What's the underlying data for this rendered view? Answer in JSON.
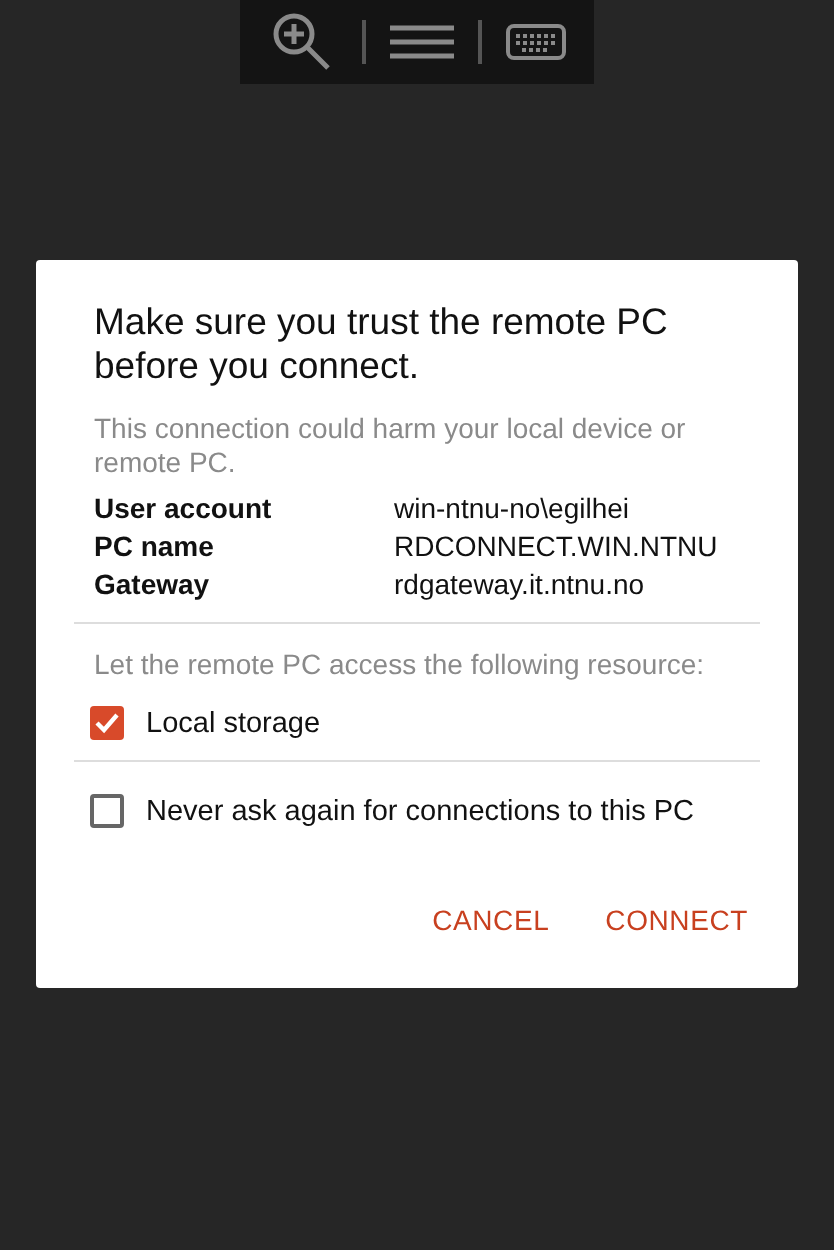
{
  "dialog": {
    "title": "Make sure you trust the remote PC before you connect.",
    "message": "This connection could harm your local device or remote PC.",
    "details": [
      {
        "label": "User account",
        "value": "win-ntnu-no\\egilhei"
      },
      {
        "label": "PC name",
        "value": "RDCONNECT.WIN.NTNU"
      },
      {
        "label": "Gateway",
        "value": "rdgateway.it.ntnu.no"
      }
    ],
    "resource_prompt": "Let the remote PC access the following resource:",
    "resources": [
      {
        "label": "Local storage",
        "checked": true
      }
    ],
    "options": [
      {
        "label": "Never ask again for connections to this PC",
        "checked": false
      }
    ],
    "buttons": [
      "CANCEL",
      "CONNECT"
    ]
  }
}
